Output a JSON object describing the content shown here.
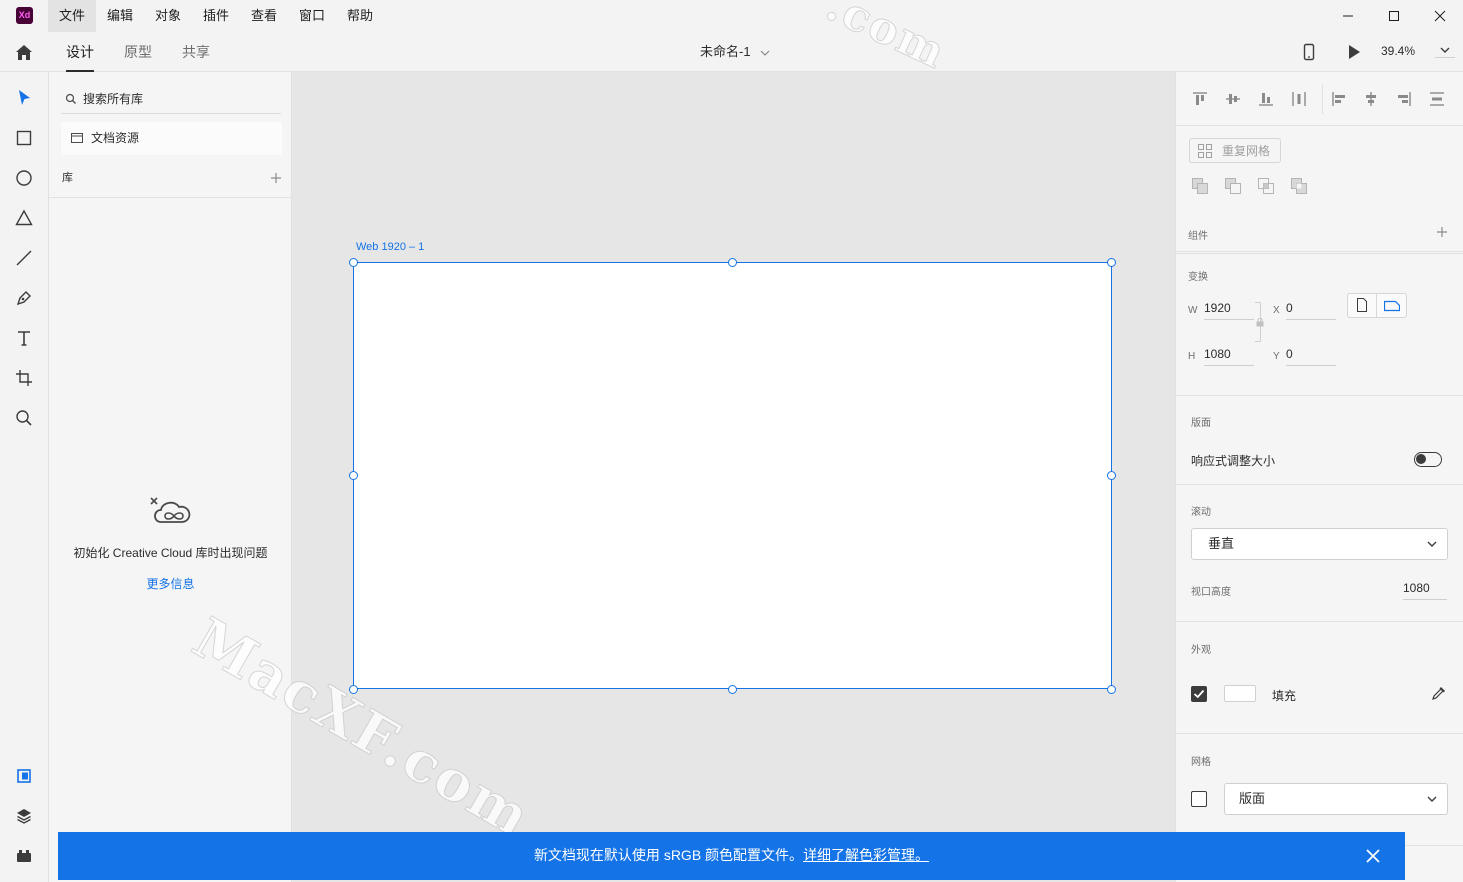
{
  "app": {
    "logo_text": "Xd"
  },
  "menu": {
    "items": [
      {
        "label": "文件"
      },
      {
        "label": "编辑"
      },
      {
        "label": "对象"
      },
      {
        "label": "插件"
      },
      {
        "label": "查看"
      },
      {
        "label": "窗口"
      },
      {
        "label": "帮助"
      }
    ]
  },
  "toolbar": {
    "tabs": [
      {
        "label": "设计"
      },
      {
        "label": "原型"
      },
      {
        "label": "共享"
      }
    ],
    "document_title": "未命名-1",
    "zoom": "39.4%"
  },
  "library": {
    "search_placeholder": "搜索所有库",
    "document_assets": "文档资源",
    "header": "库",
    "error_message": "初始化 Creative Cloud 库时出现问题",
    "more_info": "更多信息"
  },
  "canvas": {
    "artboard_name": "Web 1920 – 1",
    "watermark_top": ".com",
    "watermark_main": "MacXF.com"
  },
  "inspector": {
    "repeat_grid": "重复网格",
    "component": {
      "label": "组件"
    },
    "transform": {
      "label": "变换",
      "w_letter": "W",
      "w_value": "1920",
      "h_letter": "H",
      "h_value": "1080",
      "x_letter": "X",
      "x_value": "0",
      "y_letter": "Y",
      "y_value": "0"
    },
    "artboard": {
      "label": "版面",
      "responsive_resize": "响应式调整大小",
      "responsive_resize_on": false
    },
    "scroll": {
      "label": "滚动",
      "value": "垂直",
      "viewport_height_label": "视口高度",
      "viewport_height": "1080"
    },
    "appearance": {
      "label": "外观",
      "fill_label": "填充",
      "fill_enabled": true,
      "fill_color": "#FFFFFF"
    },
    "grid": {
      "label": "网格",
      "value": "版面",
      "enabled": false
    }
  },
  "banner": {
    "message": "新文档现在默认使用 sRGB 颜色配置文件。",
    "link": "详细了解色彩管理。"
  },
  "colors": {
    "accent": "#1473E6",
    "xd_logo_bg": "#470137",
    "xd_logo_fg": "#FF61F6"
  }
}
